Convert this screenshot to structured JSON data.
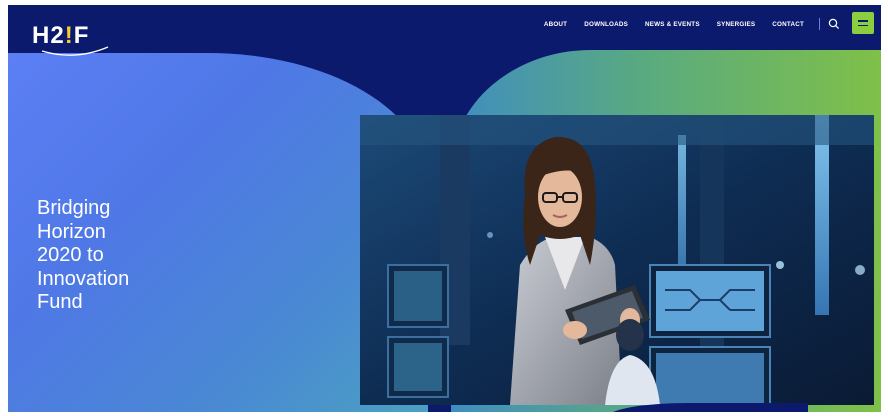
{
  "logo": {
    "prefix": "H2",
    "bulb": "!",
    "suffix": "F"
  },
  "nav": {
    "items": [
      "ABOUT",
      "DOWNLOADS",
      "NEWS & EVENTS",
      "SYNERGIES",
      "CONTACT"
    ]
  },
  "icons": {
    "search": "search-icon",
    "menu": "hamburger-icon"
  },
  "hero": {
    "title_lines": [
      "Bridging",
      "Horizon",
      "2020 to",
      "Innovation",
      "Fund"
    ]
  },
  "colors": {
    "navy": "#0c1a6e",
    "accent_green": "#8ccf3e",
    "hero_blue": "#5c7ff5"
  }
}
